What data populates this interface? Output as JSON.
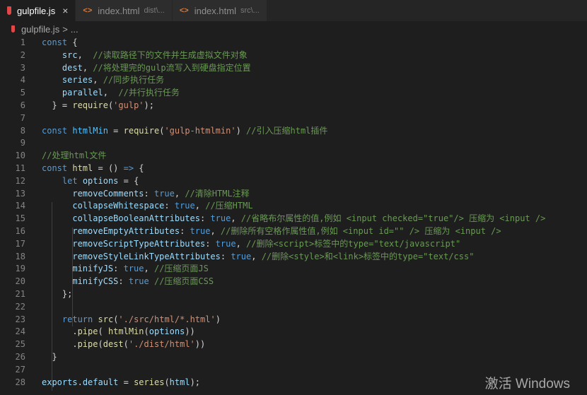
{
  "tabs": [
    {
      "label": "gulpfile.js",
      "desc": "",
      "icon": "gulp-icon",
      "active": true
    },
    {
      "label": "index.html",
      "desc": "dist\\...",
      "icon": "html-icon",
      "active": false
    },
    {
      "label": "index.html",
      "desc": "src\\...",
      "icon": "html-icon",
      "active": false
    }
  ],
  "tab_close": "×",
  "html_icon_glyph": "<>",
  "breadcrumb": {
    "file": "gulpfile.js",
    "sep": ">",
    "rest": "..."
  },
  "lines": [
    [
      [
        "k",
        "const"
      ],
      [
        "p",
        " {"
      ]
    ],
    [
      [
        "p",
        "    "
      ],
      [
        "v",
        "src"
      ],
      [
        "p",
        ",  "
      ],
      [
        "c",
        "//读取路径下的文件并生成虚拟文件对象"
      ]
    ],
    [
      [
        "p",
        "    "
      ],
      [
        "v",
        "dest"
      ],
      [
        "p",
        ", "
      ],
      [
        "c",
        "//将处理完的gulp流写入到硬盘指定位置"
      ]
    ],
    [
      [
        "p",
        "    "
      ],
      [
        "v",
        "series"
      ],
      [
        "p",
        ", "
      ],
      [
        "c",
        "//同步执行任务"
      ]
    ],
    [
      [
        "p",
        "    "
      ],
      [
        "v",
        "parallel"
      ],
      [
        "p",
        ",  "
      ],
      [
        "c",
        "//并行执行任务"
      ]
    ],
    [
      [
        "p",
        "  } = "
      ],
      [
        "f",
        "require"
      ],
      [
        "p",
        "("
      ],
      [
        "s",
        "'gulp'"
      ],
      [
        "p",
        ");"
      ]
    ],
    [],
    [
      [
        "k",
        "const"
      ],
      [
        "p",
        " "
      ],
      [
        "n",
        "htmlMin"
      ],
      [
        "p",
        " = "
      ],
      [
        "f",
        "require"
      ],
      [
        "p",
        "("
      ],
      [
        "s",
        "'gulp-htmlmin'"
      ],
      [
        "p",
        ") "
      ],
      [
        "c",
        "//引入压缩html插件"
      ]
    ],
    [],
    [
      [
        "c",
        "//处理html文件"
      ]
    ],
    [
      [
        "k",
        "const"
      ],
      [
        "p",
        " "
      ],
      [
        "f",
        "html"
      ],
      [
        "p",
        " = () "
      ],
      [
        "k",
        "=>"
      ],
      [
        "p",
        " {"
      ]
    ],
    [
      [
        "p",
        "    "
      ],
      [
        "k",
        "let"
      ],
      [
        "p",
        " "
      ],
      [
        "v",
        "options"
      ],
      [
        "p",
        " = {"
      ]
    ],
    [
      [
        "p",
        "      "
      ],
      [
        "v",
        "removeComments"
      ],
      [
        "p",
        ": "
      ],
      [
        "k",
        "true"
      ],
      [
        "p",
        ", "
      ],
      [
        "c",
        "//清除HTML注释"
      ]
    ],
    [
      [
        "p",
        "      "
      ],
      [
        "v",
        "collapseWhitespace"
      ],
      [
        "p",
        ": "
      ],
      [
        "k",
        "true"
      ],
      [
        "p",
        ", "
      ],
      [
        "c",
        "//压缩HTML"
      ]
    ],
    [
      [
        "p",
        "      "
      ],
      [
        "v",
        "collapseBooleanAttributes"
      ],
      [
        "p",
        ": "
      ],
      [
        "k",
        "true"
      ],
      [
        "p",
        ", "
      ],
      [
        "c",
        "//省略布尔属性的值,例如 <input checked=\"true\"/> 压缩为 <input />"
      ]
    ],
    [
      [
        "p",
        "      "
      ],
      [
        "v",
        "removeEmptyAttributes"
      ],
      [
        "p",
        ": "
      ],
      [
        "k",
        "true"
      ],
      [
        "p",
        ", "
      ],
      [
        "c",
        "//删除所有空格作属性值,例如 <input id=\"\" /> 压缩为 <input />"
      ]
    ],
    [
      [
        "p",
        "      "
      ],
      [
        "v",
        "removeScriptTypeAttributes"
      ],
      [
        "p",
        ": "
      ],
      [
        "k",
        "true"
      ],
      [
        "p",
        ", "
      ],
      [
        "c",
        "//删除<script>标签中的type=\"text/javascript\""
      ]
    ],
    [
      [
        "p",
        "      "
      ],
      [
        "v",
        "removeStyleLinkTypeAttributes"
      ],
      [
        "p",
        ": "
      ],
      [
        "k",
        "true"
      ],
      [
        "p",
        ", "
      ],
      [
        "c",
        "//删除<style>和<link>标签中的type=\"text/css\""
      ]
    ],
    [
      [
        "p",
        "      "
      ],
      [
        "v",
        "minifyJS"
      ],
      [
        "p",
        ": "
      ],
      [
        "k",
        "true"
      ],
      [
        "p",
        ", "
      ],
      [
        "c",
        "//压缩页面JS"
      ]
    ],
    [
      [
        "p",
        "      "
      ],
      [
        "v",
        "minifyCSS"
      ],
      [
        "p",
        ": "
      ],
      [
        "k",
        "true"
      ],
      [
        "p",
        " "
      ],
      [
        "c",
        "//压缩页面CSS"
      ]
    ],
    [
      [
        "p",
        "    };"
      ]
    ],
    [],
    [
      [
        "p",
        "    "
      ],
      [
        "k",
        "return"
      ],
      [
        "p",
        " "
      ],
      [
        "f",
        "src"
      ],
      [
        "p",
        "("
      ],
      [
        "s",
        "'./src/html/*.html'"
      ],
      [
        "p",
        ")"
      ]
    ],
    [
      [
        "p",
        "      ."
      ],
      [
        "f",
        "pipe"
      ],
      [
        "p",
        "( "
      ],
      [
        "f",
        "htmlMin"
      ],
      [
        "p",
        "("
      ],
      [
        "v",
        "options"
      ],
      [
        "p",
        "))"
      ]
    ],
    [
      [
        "p",
        "      ."
      ],
      [
        "f",
        "pipe"
      ],
      [
        "p",
        "("
      ],
      [
        "f",
        "dest"
      ],
      [
        "p",
        "("
      ],
      [
        "s",
        "'./dist/html'"
      ],
      [
        "p",
        "))"
      ]
    ],
    [
      [
        "p",
        "  }"
      ]
    ],
    [],
    [
      [
        "v",
        "exports"
      ],
      [
        "p",
        "."
      ],
      [
        "v",
        "default"
      ],
      [
        "p",
        " = "
      ],
      [
        "f",
        "series"
      ],
      [
        "p",
        "("
      ],
      [
        "v",
        "html"
      ],
      [
        "p",
        ");"
      ]
    ]
  ],
  "watermark": "激活 Windows"
}
